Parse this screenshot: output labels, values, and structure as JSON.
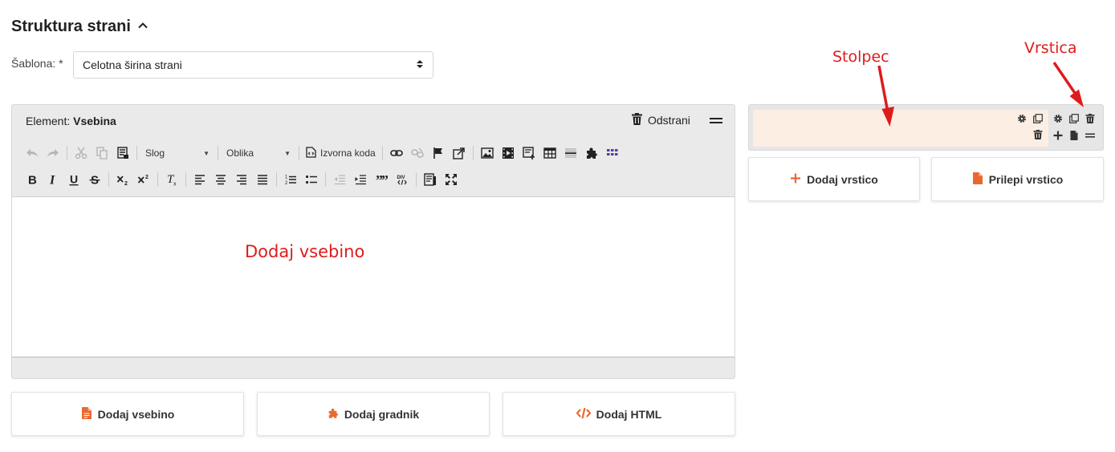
{
  "section": {
    "title": "Struktura strani"
  },
  "template": {
    "label": "Šablona: *",
    "value": "Celotna širina strani"
  },
  "editor": {
    "element_prefix": "Element:",
    "element_name": "Vsebina",
    "remove_label": "Odstrani",
    "style_combo": "Slog",
    "format_combo": "Oblika",
    "source_label": "Izvorna koda",
    "content_placeholder": "Dodaj vsebino"
  },
  "buttons": {
    "add_content": "Dodaj vsebino",
    "add_widget": "Dodaj gradnik",
    "add_html": "Dodaj HTML",
    "add_row": "Dodaj vrstico",
    "paste_row": "Prilepi vrstico"
  },
  "annotations": {
    "column": "Stolpec",
    "row": "Vrstica"
  },
  "colors": {
    "accent": "#e8692f",
    "annotation": "#dd1c1c",
    "column_bg": "#fdeee3"
  }
}
